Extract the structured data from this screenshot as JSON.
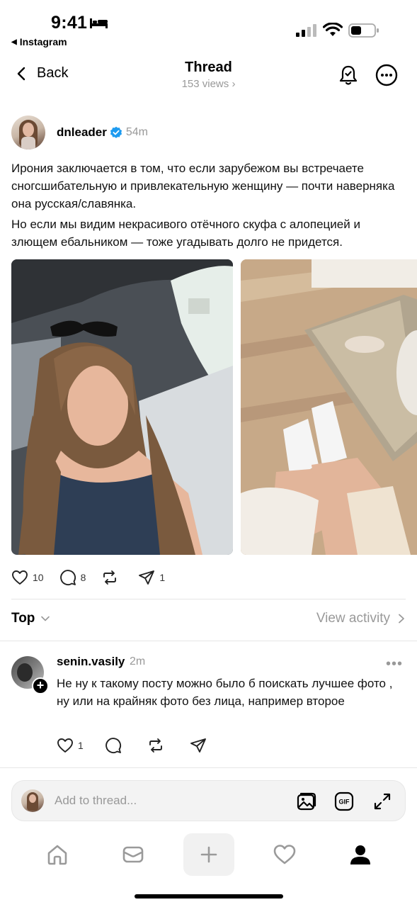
{
  "status_bar": {
    "time": "9:41",
    "back_app": "Instagram",
    "icons": [
      "bed-icon",
      "signal-icon",
      "wifi-icon",
      "battery-icon"
    ]
  },
  "nav": {
    "back_label": "Back",
    "title": "Thread",
    "views": "153 views",
    "icons": [
      "chevron-left-icon",
      "bell-check-icon",
      "more-icon"
    ]
  },
  "post": {
    "username": "dnleader",
    "time": "54m",
    "verified": true,
    "paragraphs": [
      "Ирония заключается в том, что если зарубежом вы встречаете сногсшибательную и привлекательную женщину — почти наверняка она русская/славянка.",
      "Но если мы видим некрасивого отёчного скуфа с алопецией и злющем ебальником — тоже угадывать долго не придется."
    ],
    "likes": "10",
    "comments": "8",
    "shares": "1"
  },
  "sort": {
    "label": "Top",
    "view_activity": "View activity"
  },
  "reply": {
    "username": "senin.vasily",
    "time": "2m",
    "more": "•••",
    "text": "Не ну к такому посту можно  было б поискать лучшее фото , ну или на крайняк  фото без лица, например второе",
    "likes": "1"
  },
  "composer": {
    "placeholder": "Add to thread...",
    "icons": [
      "image-icon",
      "gif-icon",
      "expand-icon"
    ]
  },
  "tabbar": {
    "items": [
      "home-icon",
      "messages-icon",
      "plus-icon",
      "heart-icon",
      "profile-icon"
    ]
  },
  "colors": {
    "verified_blue": "#1d9bf0",
    "secondary_text": "#999999",
    "divider": "#e6e6e6"
  }
}
